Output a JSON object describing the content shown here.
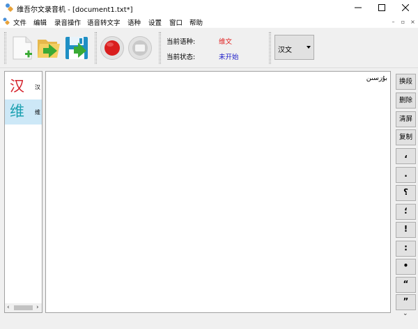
{
  "window": {
    "title": "维吾尔文录音机 - [document1.txt*]"
  },
  "menu": [
    "文件",
    "编辑",
    "录音操作",
    "语音转文字",
    "语种",
    "设置",
    "窗口",
    "帮助"
  ],
  "toolbar": {
    "buttons": [
      "new-file-icon",
      "open-folder-icon",
      "save-icon",
      "record-icon",
      "stop-icon"
    ],
    "info": {
      "lang_label": "当前语种:",
      "lang_value": "维文",
      "status_label": "当前状态:",
      "status_value": "未开始"
    },
    "lang_select": "汉文"
  },
  "language_list": [
    {
      "glyph": "汉",
      "name": "汉",
      "color": "#d4202a"
    },
    {
      "glyph": "维",
      "name": "维",
      "color": "#1aa0b0"
    }
  ],
  "editor": {
    "tag": "ﺑﯘﺯﺳﯩﻦ"
  },
  "side_buttons": [
    "换段",
    "删除",
    "清屏",
    "复制",
    "،",
    ".",
    "؟",
    "؛",
    "!",
    ":",
    "•",
    "“",
    "”"
  ],
  "colors": {
    "lang_value": "#e02020",
    "status_value": "#1a1ac8",
    "selected_item": "#cde8f7"
  }
}
